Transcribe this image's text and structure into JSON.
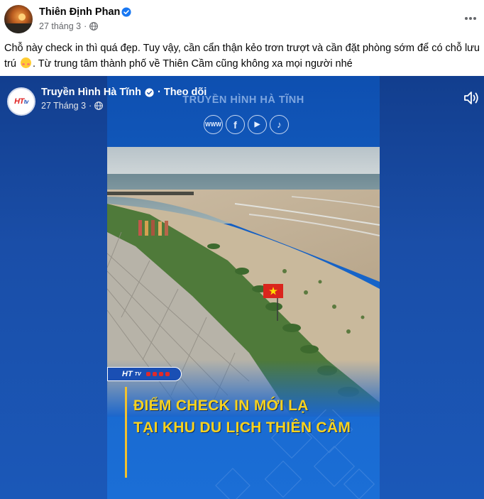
{
  "post": {
    "author": "Thiên Định Phan",
    "date": "27 tháng 3",
    "separator": "·",
    "caption": "Chỗ này check in thì quá đẹp. Tuy vậy, cần cẩn thận kẻo trơn trượt và cần đặt phòng sớm để có chỗ lưu trú",
    "caption_tail": "Từ trung tâm thành phố về Thiên Cầm cũng không xa mọi người nhé"
  },
  "shared": {
    "page_name": "Truyền Hình Hà Tĩnh",
    "follow": "· Theo dõi",
    "date": "27 Tháng 3",
    "logo_text": "HT",
    "logo_suffix": "tv"
  },
  "video": {
    "watermark": "TRUYỀN HÌNH HÀ TĨNH",
    "social": [
      "WWW",
      "f",
      "▶",
      "♪"
    ],
    "channel_tag": "HT",
    "channel_tag_suffix": "TV",
    "headline_1": "ĐIỂM CHECK IN MỚI LẠ",
    "headline_2": "TẠI KHU DU LỊCH THIÊN CẦM"
  },
  "colors": {
    "accent": "#1877f2",
    "headline": "#f7d21f",
    "video_bg": "#1a4ea8"
  },
  "icons": {
    "verified": "verified-badge-icon",
    "globe": "globe-icon",
    "more": "more-options-icon",
    "sound": "sound-icon",
    "flag": "vietnam-flag-icon"
  }
}
